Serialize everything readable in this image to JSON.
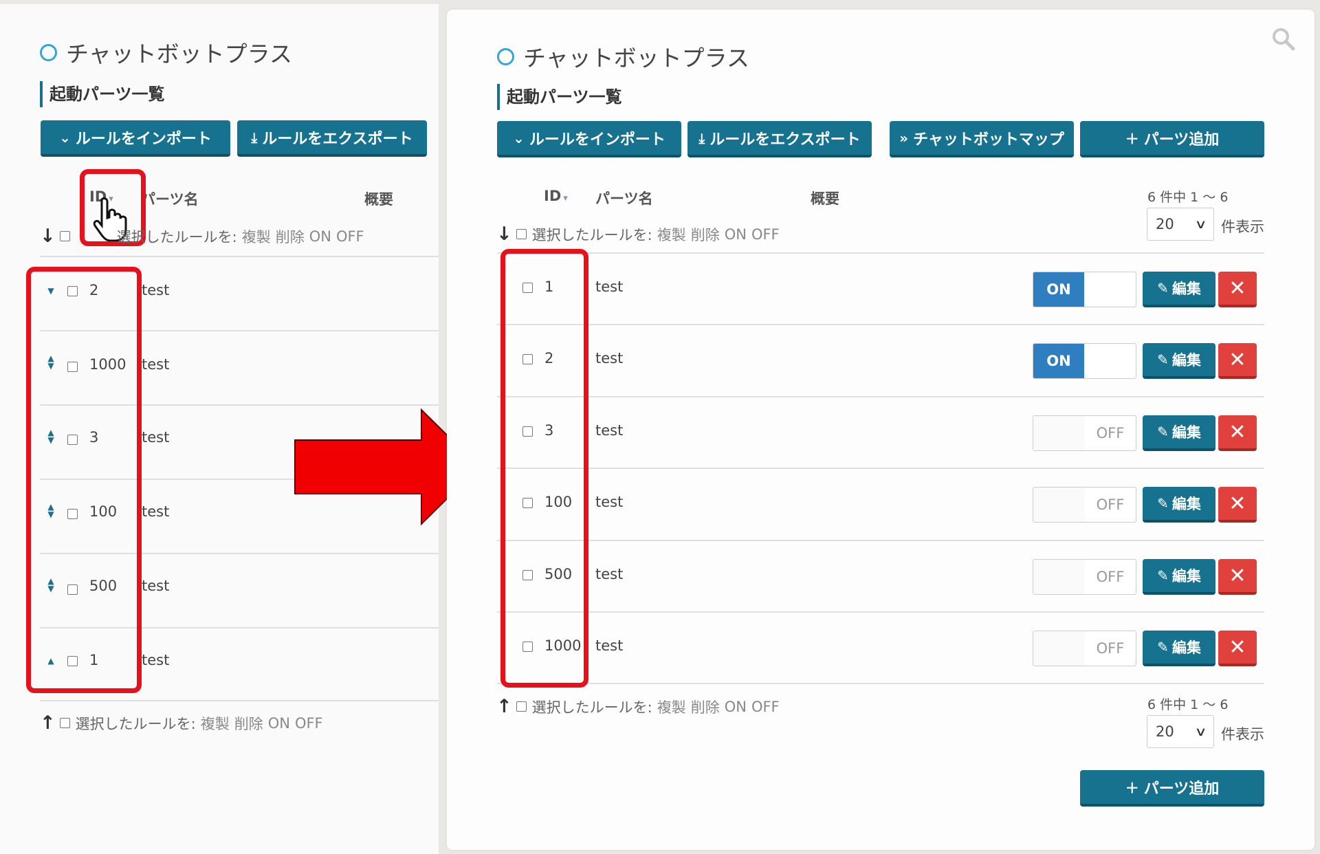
{
  "app_title": "チャットボットプラス",
  "section_title": "起動パーツ一覧",
  "buttons": {
    "import": "ルールをインポート",
    "export": "ルールをエクスポート",
    "map": "チャットボットマップ",
    "add": "パーツ追加"
  },
  "columns": {
    "id": "ID",
    "name": "パーツ名",
    "summary": "概要"
  },
  "bulk_actions": {
    "label": "選択したルールを:",
    "actions": [
      "複製",
      "削除",
      "ON",
      "OFF"
    ]
  },
  "pagination": {
    "info": "6 件中 1 〜 6",
    "per_page_value": "20",
    "per_page_label": "件表示"
  },
  "left_rows": [
    {
      "id": "2",
      "name": "test"
    },
    {
      "id": "1000",
      "name": "test"
    },
    {
      "id": "3",
      "name": "test"
    },
    {
      "id": "100",
      "name": "test"
    },
    {
      "id": "500",
      "name": "test"
    },
    {
      "id": "1",
      "name": "test"
    }
  ],
  "right_rows": [
    {
      "id": "1",
      "name": "test",
      "toggle": "ON"
    },
    {
      "id": "2",
      "name": "test",
      "toggle": "ON"
    },
    {
      "id": "3",
      "name": "test",
      "toggle": "OFF"
    },
    {
      "id": "100",
      "name": "test",
      "toggle": "OFF"
    },
    {
      "id": "500",
      "name": "test",
      "toggle": "OFF"
    },
    {
      "id": "1000",
      "name": "test",
      "toggle": "OFF"
    }
  ],
  "row_actions": {
    "edit": "編集",
    "delete": "✕"
  },
  "colors": {
    "primary": "#17728f",
    "on": "#2f7fc0",
    "danger": "#e0413d",
    "highlight": "#e8101a"
  },
  "icons": [
    "search-icon",
    "chevron-down-icon",
    "download-icon",
    "double-chevron-icon",
    "plus-icon",
    "pencil-icon",
    "close-icon",
    "arrow-down-icon",
    "arrow-up-icon",
    "hand-cursor-icon",
    "arrow-right-icon"
  ]
}
